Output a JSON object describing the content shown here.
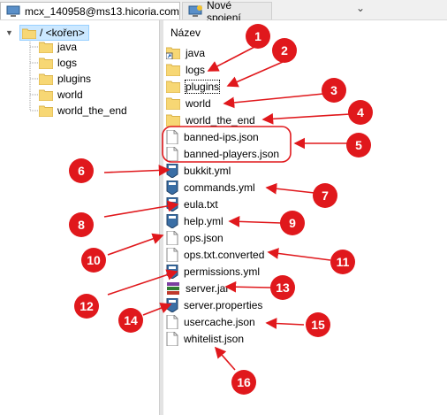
{
  "tabs": [
    {
      "label": "mcx_140958@ms13.hicoria.com",
      "icon": "computer-icon",
      "active": true
    },
    {
      "label": "Nové spojení",
      "icon": "new-connection-icon",
      "active": false
    }
  ],
  "tab_dropdown_icon": "chevron-down-icon",
  "tree": {
    "root_label": "/ <kořen>",
    "items": [
      "java",
      "logs",
      "plugins",
      "world",
      "world_the_end"
    ]
  },
  "files": {
    "column_header": "Název",
    "items": [
      {
        "name": "java",
        "icon": "folder-shortcut-icon"
      },
      {
        "name": "logs",
        "icon": "folder-icon"
      },
      {
        "name": "plugins",
        "icon": "folder-icon"
      },
      {
        "name": "world",
        "icon": "folder-icon"
      },
      {
        "name": "world_the_end",
        "icon": "folder-icon"
      },
      {
        "name": "banned-ips.json",
        "icon": "file-icon"
      },
      {
        "name": "banned-players.json",
        "icon": "file-icon"
      },
      {
        "name": "bukkit.yml",
        "icon": "config-file-icon"
      },
      {
        "name": "commands.yml",
        "icon": "config-file-icon"
      },
      {
        "name": "eula.txt",
        "icon": "config-file-icon"
      },
      {
        "name": "help.yml",
        "icon": "config-file-icon"
      },
      {
        "name": "ops.json",
        "icon": "file-icon"
      },
      {
        "name": "ops.txt.converted",
        "icon": "file-icon"
      },
      {
        "name": "permissions.yml",
        "icon": "config-file-icon"
      },
      {
        "name": "server.jar",
        "icon": "archive-icon"
      },
      {
        "name": "server.properties",
        "icon": "config-file-icon"
      },
      {
        "name": "usercache.json",
        "icon": "file-icon"
      },
      {
        "name": "whitelist.json",
        "icon": "file-icon"
      }
    ]
  },
  "annotations": [
    "1",
    "2",
    "3",
    "4",
    "5",
    "6",
    "7",
    "8",
    "9",
    "10",
    "11",
    "12",
    "13",
    "14",
    "15",
    "16"
  ],
  "colors": {
    "annotation_red": "#e0181c",
    "selection": "#cce8ff",
    "folder": "#f7d774"
  }
}
